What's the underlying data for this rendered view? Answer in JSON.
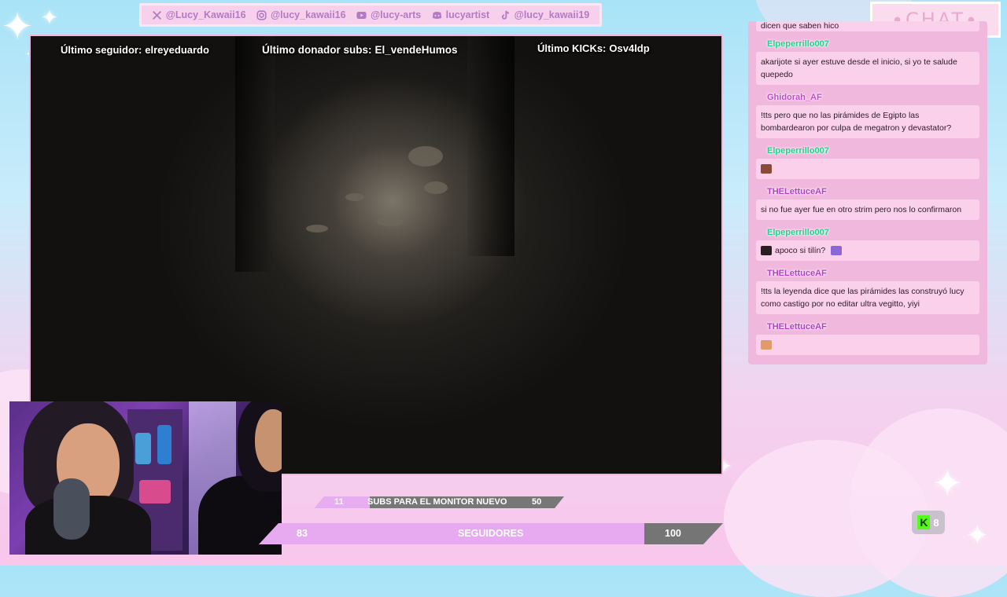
{
  "social": [
    {
      "icon": "x-icon",
      "handle": "@Lucy_Kawaii16"
    },
    {
      "icon": "instagram-icon",
      "handle": "@lucy_kawaii16"
    },
    {
      "icon": "youtube-icon",
      "handle": "@lucy-arts"
    },
    {
      "icon": "discord-icon",
      "handle": "lucyartist"
    },
    {
      "icon": "tiktok-icon",
      "handle": "@lucy_kawaii19"
    }
  ],
  "chat_header": {
    "title": "CHAT",
    "color": "#e8a9cf"
  },
  "stream_labels": {
    "follower_label": "Último seguidor:",
    "follower_value": "elreyeduardo",
    "donor_label": "Último donador subs:",
    "donor_value": "El_vendeHumos",
    "kicks_label": "Último KICKs:",
    "kicks_value": "Osv4ldp"
  },
  "chat": {
    "cut_top": "dicen que saben hico",
    "messages": [
      {
        "user": "Elpeperrillo007",
        "user_color": "#1fd18a",
        "text": "akarijote si ayer estuve desde el inicio, si yo te salude quepedo"
      },
      {
        "user": "Ghidorah_AF",
        "user_color": "#c04cc8",
        "text": "!tts pero que no las pirámides de Egipto las bombardearon por culpa de megatron y devastator?"
      },
      {
        "user": "Elpeperrillo007",
        "user_color": "#1fd18a",
        "text": "",
        "emote": "emote-brown"
      },
      {
        "user": "THELettuceAF",
        "user_color": "#b03fc4",
        "text": "si no fue ayer fue en otro strim pero nos lo confirmaron"
      },
      {
        "user": "Elpeperrillo007",
        "user_color": "#1fd18a",
        "text": "apoco si tilín?",
        "emote": "emote-dark",
        "emote2": "emote-purple"
      },
      {
        "user": "THELettuceAF",
        "user_color": "#b03fc4",
        "text": "!tts la leyenda dice que las pirámides las construyó lucy como castigo por no editar ultra vegitto, yiyi"
      },
      {
        "user": "THELettuceAF",
        "user_color": "#b03fc4",
        "text": "",
        "emote": "emote-orange"
      }
    ]
  },
  "goal": {
    "current": "11",
    "label": "SUBS PARA EL MONITOR NUEVO",
    "target": "50",
    "progress": 0.22
  },
  "followers": {
    "current": "83",
    "label": "SEGUIDORES",
    "target": "100",
    "progress": 0.83
  },
  "kick_badge": {
    "count": "8",
    "color": "#53fc18"
  }
}
